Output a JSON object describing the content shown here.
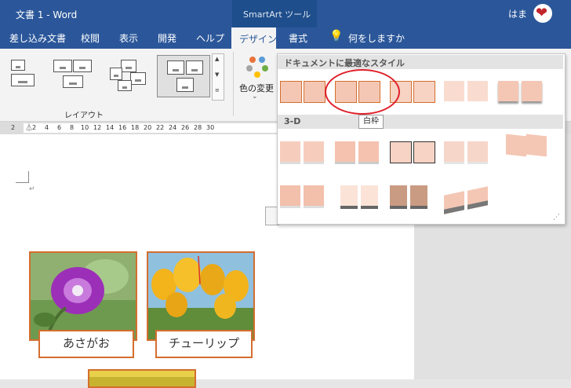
{
  "titlebar": {
    "doc_title": "文書 1 - Word",
    "context_title": "SmartArt ツール",
    "user": "はま"
  },
  "tabs": [
    {
      "label": "差し込み文書"
    },
    {
      "label": "校閲"
    },
    {
      "label": "表示"
    },
    {
      "label": "開発"
    },
    {
      "label": "ヘルプ"
    },
    {
      "label": "デザイン"
    },
    {
      "label": "書式"
    },
    {
      "label": "何をしますか"
    }
  ],
  "ribbon": {
    "layout_group_label": "レイアウト",
    "colors_label": "色の変更"
  },
  "ruler": {
    "ticks": [
      "2",
      "2",
      "4",
      "6",
      "8",
      "10",
      "12",
      "14",
      "16",
      "18",
      "20",
      "22",
      "24",
      "26",
      "28",
      "30"
    ]
  },
  "gallery": {
    "section1": "ドキュメントに最適なスタイル",
    "section2": "3-D",
    "tooltip": "白枠",
    "accent": "#d46e2f",
    "fill": "#f4c7b4"
  },
  "pictures": [
    {
      "caption": "あさがお"
    },
    {
      "caption": "チューリップ"
    }
  ],
  "colors": {
    "titlebar": "#2b579a",
    "highlight": "#e0202a"
  }
}
